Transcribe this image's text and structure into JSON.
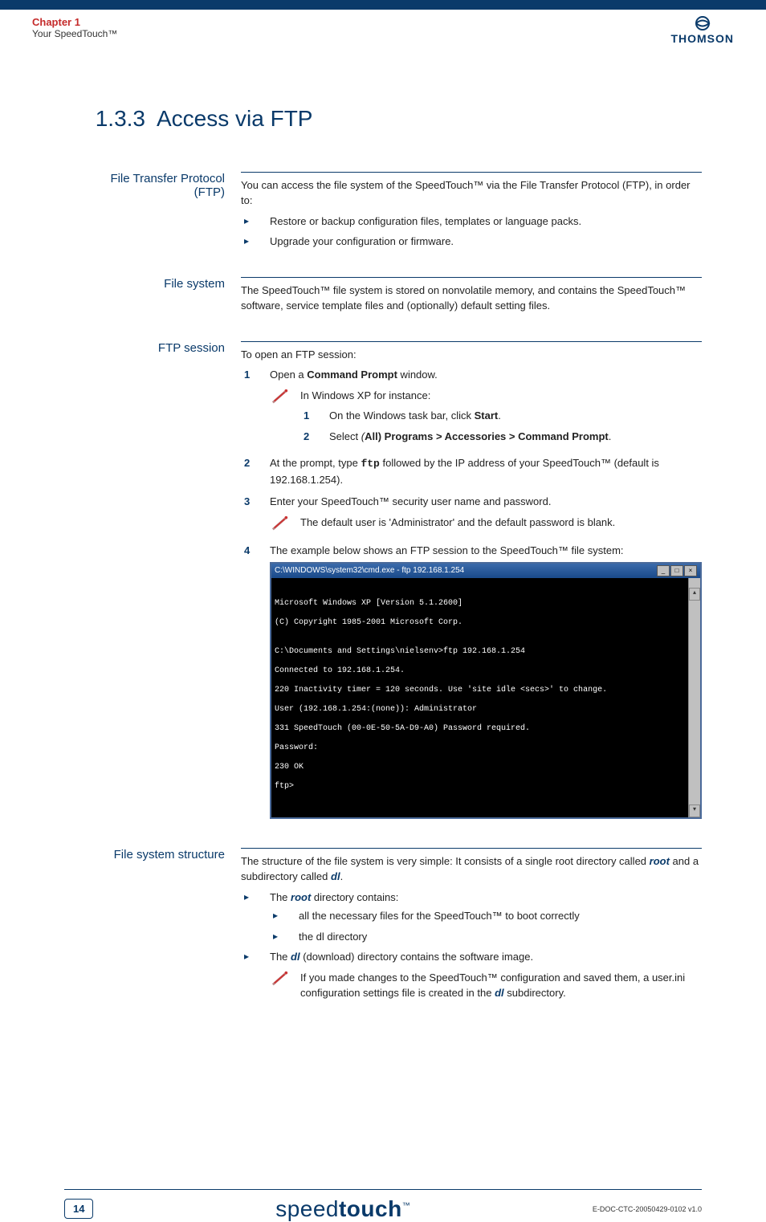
{
  "header": {
    "chapter": "Chapter 1",
    "subtitle": "Your SpeedTouch™",
    "brand": "THOMSON"
  },
  "title": {
    "num": "1.3.3",
    "text": "Access via FTP"
  },
  "sections": {
    "ftp_intro": {
      "label": "File Transfer Protocol (FTP)",
      "intro": "You can access the file system of the SpeedTouch™ via the File Transfer Protocol (FTP), in order to:",
      "bullets": [
        "Restore or backup configuration files, templates or language packs.",
        "Upgrade your configuration or firmware."
      ]
    },
    "file_system": {
      "label": "File system",
      "text": "The SpeedTouch™ file system is stored on nonvolatile memory, and contains the SpeedTouch™ software, service template files and (optionally) default setting files."
    },
    "ftp_session": {
      "label": "FTP session",
      "intro": "To open an FTP session:",
      "step1": {
        "pre": "Open a ",
        "bold": "Command Prompt",
        "post": " window."
      },
      "note1": "In Windows XP for instance:",
      "sub1": {
        "pre": "On the Windows task bar, click ",
        "bold": "Start",
        "post": "."
      },
      "sub2": {
        "pre": "Select ",
        "italic": "(",
        "bold": "All) Programs > Accessories > Command Prompt",
        "post": "."
      },
      "step2": {
        "pre": "At the prompt, type ",
        "mono": "ftp",
        "post": " followed by the IP address of your SpeedTouch™ (default is 192.168.1.254)."
      },
      "step3": "Enter your SpeedTouch™ security user name and password.",
      "note3": "The default user is 'Administrator' and the default password is blank.",
      "step4": "The example below shows an FTP session to the SpeedTouch™ file system:",
      "terminal_title": "C:\\WINDOWS\\system32\\cmd.exe - ftp 192.168.1.254",
      "terminal_lines": [
        "Microsoft Windows XP [Version 5.1.2600]",
        "(C) Copyright 1985-2001 Microsoft Corp.",
        "",
        "C:\\Documents and Settings\\nielsenv>ftp 192.168.1.254",
        "Connected to 192.168.1.254.",
        "220 Inactivity timer = 120 seconds. Use 'site idle <secs>' to change.",
        "User (192.168.1.254:(none)): Administrator",
        "331 SpeedTouch (00-0E-50-5A-D9-A0) Password required.",
        "Password:",
        "230 OK",
        "ftp>"
      ]
    },
    "fs_structure": {
      "label": "File system structure",
      "intro_pre": "The structure of the file system is very simple: It consists of a single root directory called ",
      "root": "root",
      "intro_mid": " and  a subdirectory called ",
      "dl": "dl",
      "intro_post": ".",
      "b1_pre": "The ",
      "b1_bold": "root",
      "b1_post": " directory contains:",
      "b1_sub1": "all the necessary files for the SpeedTouch™ to boot correctly",
      "b1_sub2": "the dl directory",
      "b2_pre": "The ",
      "b2_bold": "dl",
      "b2_post": " (download) directory contains the software image.",
      "note_pre": "If you made changes to the SpeedTouch™ configuration and saved them, a user.ini configuration settings file is created in the ",
      "note_bold": "dl",
      "note_post": " subdirectory."
    }
  },
  "footer": {
    "page": "14",
    "logo_thin": "speed",
    "logo_bold": "touch",
    "tm": "™",
    "docref": "E-DOC-CTC-20050429-0102 v1.0"
  }
}
